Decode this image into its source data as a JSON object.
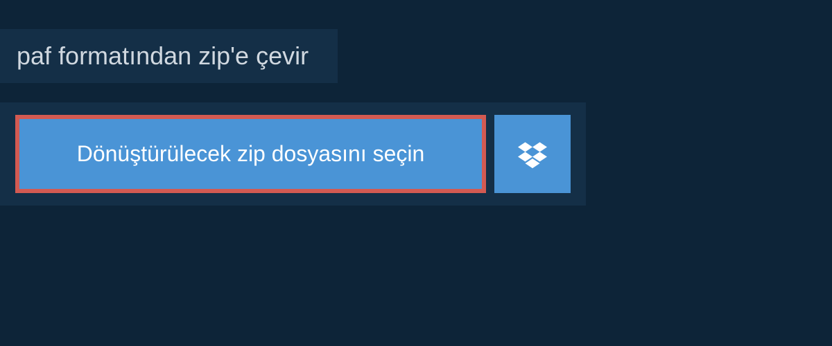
{
  "header": {
    "title": "paf formatından zip'e çevir"
  },
  "main": {
    "file_select_label": "Dönüştürülecek zip dosyasını seçin"
  },
  "colors": {
    "page_bg": "#0d2438",
    "panel_bg": "#142f47",
    "button_bg": "#4a94d6",
    "highlight_border": "#d35a52",
    "text_light": "#d0d8e0",
    "text_white": "#ffffff"
  }
}
